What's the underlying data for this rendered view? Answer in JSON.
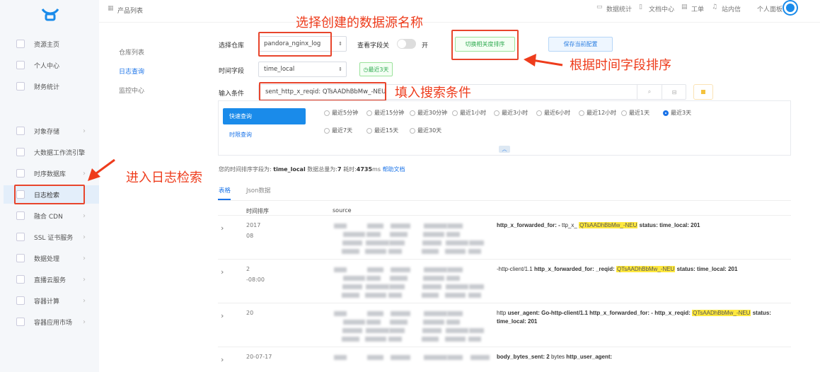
{
  "header": {
    "breadcrumb": "产品列表",
    "links": [
      "数据统计",
      "文档中心",
      "工单",
      "站内信"
    ],
    "user": "个人面板"
  },
  "sidebar": {
    "items": [
      {
        "label": "资源主页"
      },
      {
        "label": "个人中心"
      },
      {
        "label": "财务统计"
      },
      {
        "label": "对象存储"
      },
      {
        "label": "大数据工作流引擎"
      },
      {
        "label": "时序数据库"
      },
      {
        "label": "日志检索"
      },
      {
        "label": "融合 CDN"
      },
      {
        "label": "SSL 证书服务"
      },
      {
        "label": "数据处理"
      },
      {
        "label": "直播云服务"
      },
      {
        "label": "容器计算"
      },
      {
        "label": "容器应用市场"
      }
    ]
  },
  "subnav": {
    "items": [
      "仓库列表",
      "日志查询",
      "监控中心"
    ]
  },
  "form": {
    "repo_label": "选择仓库",
    "repo_value": "pandora_nginx_log",
    "fields_label": "查看字段关",
    "fields_on": "开",
    "switch_sort": "切换相关度排序",
    "save_config": "保存当前配置",
    "time_field_label": "时间字段",
    "time_field_value": "time_local",
    "time_range": "最近3天",
    "query_label": "输入条件",
    "query_value": "sent_http_x_reqid: QTsAADhBbMw_-NEU"
  },
  "quick": {
    "tab_quick": "快速查询",
    "tab_time": "时限查询",
    "options": [
      "最近5分钟",
      "最近15分钟",
      "最近30分钟",
      "最近1小时",
      "最近3小时",
      "最近6小时",
      "最近12小时",
      "最近1天",
      "最近3天",
      "最近7天",
      "最近15天",
      "最近30天"
    ],
    "selected": "最近3天"
  },
  "info": {
    "prefix": "您的时间排序字段为:",
    "field": "time_local",
    "total_label": "数据总量为:",
    "total": "7",
    "time_label": "耗时:",
    "time": "4735",
    "unit": "ms",
    "help": "帮助文档"
  },
  "tabs": [
    "表格",
    "Json数据"
  ],
  "table": {
    "headers": [
      "时间排序",
      "source"
    ],
    "rows": [
      {
        "time": [
          "2017",
          "08"
        ],
        "frag": [
          "http_x_forwarded_for: -",
          "ttp_x_",
          "QTsAADhBbMw_-NEU",
          "status:",
          "time_local: 201"
        ]
      },
      {
        "time": [
          "2",
          "-08:00"
        ],
        "frag": [
          "-http-client/1.1",
          "http_x_forwarded_for:",
          "_reqid:",
          "QTsAADhBbMw_-NEU",
          "status:",
          "time_local: 201"
        ]
      },
      {
        "time": [
          "20",
          ""
        ],
        "frag": [
          "http",
          "user_agent: Go-http-client/1.1",
          "http_x_forwarded_for: -",
          "http_x_reqid:",
          "QTsAADhBbMw_-NEU",
          "status:",
          "time_local: 201"
        ]
      },
      {
        "time": [
          "20-07-17"
        ],
        "frag": [
          "body_bytes_sent: 2",
          "bytes",
          "http_user_agent:"
        ]
      }
    ]
  },
  "annotations": {
    "datasource": "选择创建的数据源名称",
    "sort": "根据时间字段排序",
    "query": "填入搜索条件",
    "enter": "进入日志检索"
  }
}
